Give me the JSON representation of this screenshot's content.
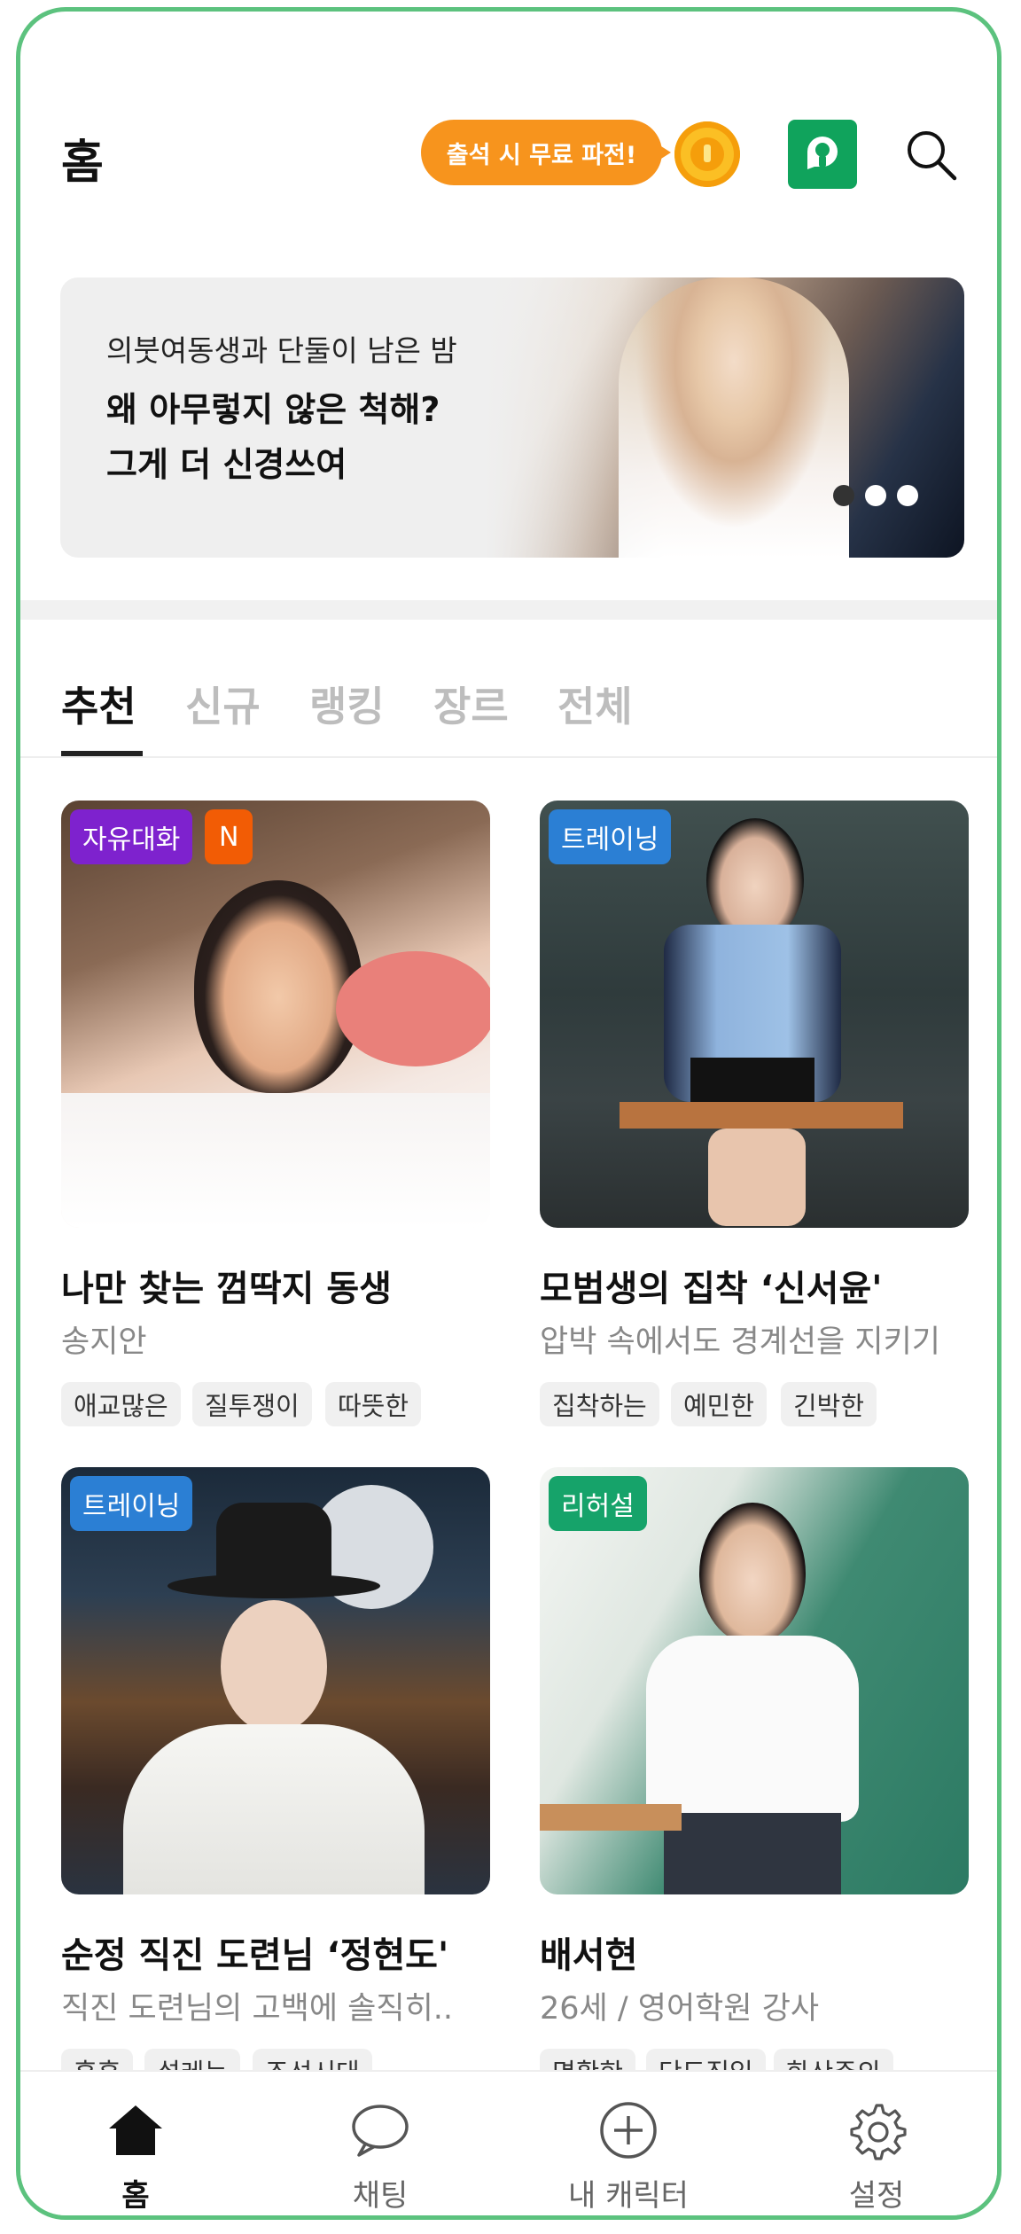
{
  "header": {
    "title": "홈",
    "promo_label": "출석 시 무료 파전!"
  },
  "banner": {
    "subtitle": "의붓여동생과 단둘이 남은 밤",
    "headline1": "왜 아무렇지 않은 척해?",
    "headline2": "그게 더 신경쓰여"
  },
  "tabs": [
    "추천",
    "신규",
    "랭킹",
    "장르",
    "전체"
  ],
  "cards": [
    {
      "badge": "자유대화",
      "badge2": "N",
      "title": "나만 찾는 껌딱지 동생",
      "subtitle": "송지안",
      "tags": [
        "애교많은",
        "질투쟁이",
        "따뜻한"
      ]
    },
    {
      "badge": "트레이닝",
      "title": "모범생의 집착 ‘신서윤'",
      "subtitle": "압박 속에서도 경계선을 지키기",
      "tags": [
        "집착하는",
        "예민한",
        "긴박한"
      ]
    },
    {
      "badge": "트레이닝",
      "title": "순정 직진 도련님 ‘정현도'",
      "subtitle": "직진 도련님의 고백에 솔직히..",
      "tags": [
        "훈훈",
        "설레는",
        "조선시대"
      ]
    },
    {
      "badge": "리허설",
      "title": "배서현",
      "subtitle": "26세 / 영어학원 강사",
      "tags": [
        "명확한",
        "단도직입",
        "화산주의"
      ]
    }
  ],
  "bottom_nav": [
    {
      "label": "홈",
      "icon": "home-icon"
    },
    {
      "label": "채팅",
      "icon": "chat-icon"
    },
    {
      "label": "내 캐릭터",
      "icon": "plus-circle-icon"
    },
    {
      "label": "설정",
      "icon": "gear-icon"
    }
  ],
  "colors": {
    "frame": "#5cc27e",
    "promo": "#f7941d",
    "badge_free": "#7e22ce",
    "badge_new": "#f25c05",
    "badge_training": "#2b7fd4",
    "badge_rehearsal": "#16a36a"
  }
}
